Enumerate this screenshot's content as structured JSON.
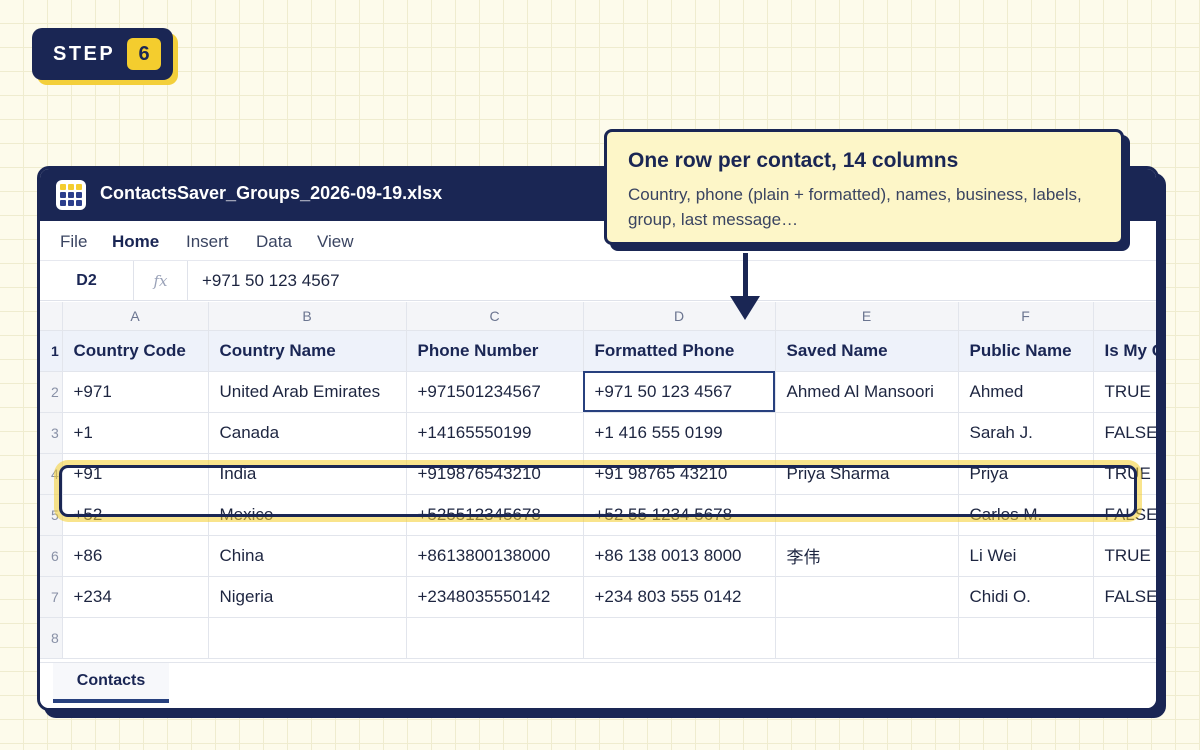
{
  "step": {
    "label": "STEP",
    "number": "6"
  },
  "window": {
    "title": "ContactsSaver_Groups_2026-09-19.xlsx"
  },
  "menu": [
    "File",
    "Home",
    "Insert",
    "Data",
    "View"
  ],
  "menu_active": "Home",
  "formula": {
    "cell_ref": "D2",
    "fx": "fx",
    "value": "+971 50 123 4567"
  },
  "columns": [
    "A",
    "B",
    "C",
    "D",
    "E",
    "F",
    ""
  ],
  "header_row": {
    "num": "1",
    "cells": [
      "Country Code",
      "Country Name",
      "Phone Number",
      "Formatted Phone",
      "Saved Name",
      "Public Name",
      "Is My C"
    ]
  },
  "rows": [
    {
      "num": "2",
      "cells": [
        "+971",
        "United Arab Emirates",
        "+971501234567",
        "+971 50 123 4567",
        "Ahmed Al Mansoori",
        "Ahmed",
        "TRUE"
      ]
    },
    {
      "num": "3",
      "cells": [
        "+1",
        "Canada",
        "+14165550199",
        "+1 416 555 0199",
        "",
        "Sarah J.",
        "FALSE"
      ]
    },
    {
      "num": "4",
      "cells": [
        "+91",
        "India",
        "+919876543210",
        "+91 98765 43210",
        "Priya Sharma",
        "Priya",
        "TRUE"
      ]
    },
    {
      "num": "5",
      "cells": [
        "+52",
        "Mexico",
        "+525512345678",
        "+52 55 1234 5678",
        "",
        "Carlos M.",
        "FALSE"
      ]
    },
    {
      "num": "6",
      "cells": [
        "+86",
        "China",
        "+8613800138000",
        "+86 138 0013 8000",
        "李伟",
        "Li Wei",
        "TRUE"
      ]
    },
    {
      "num": "7",
      "cells": [
        "+234",
        "Nigeria",
        "+2348035550142",
        "+234 803 555 0142",
        "",
        "Chidi O.",
        "FALSE"
      ]
    },
    {
      "num": "8",
      "cells": [
        "",
        "",
        "",
        "",
        "",
        "",
        ""
      ]
    }
  ],
  "sheet_tabs": [
    "Contacts"
  ],
  "callout": {
    "title": "One row per contact, 14 columns",
    "body": "Country, phone (plain + formatted), names, business, labels, group, last message…"
  },
  "colors": {
    "navy": "#1a2654",
    "accent_yellow": "#f4cd2e",
    "callout_bg": "#fdf6c8",
    "header_row_bg": "#eef2fa"
  }
}
